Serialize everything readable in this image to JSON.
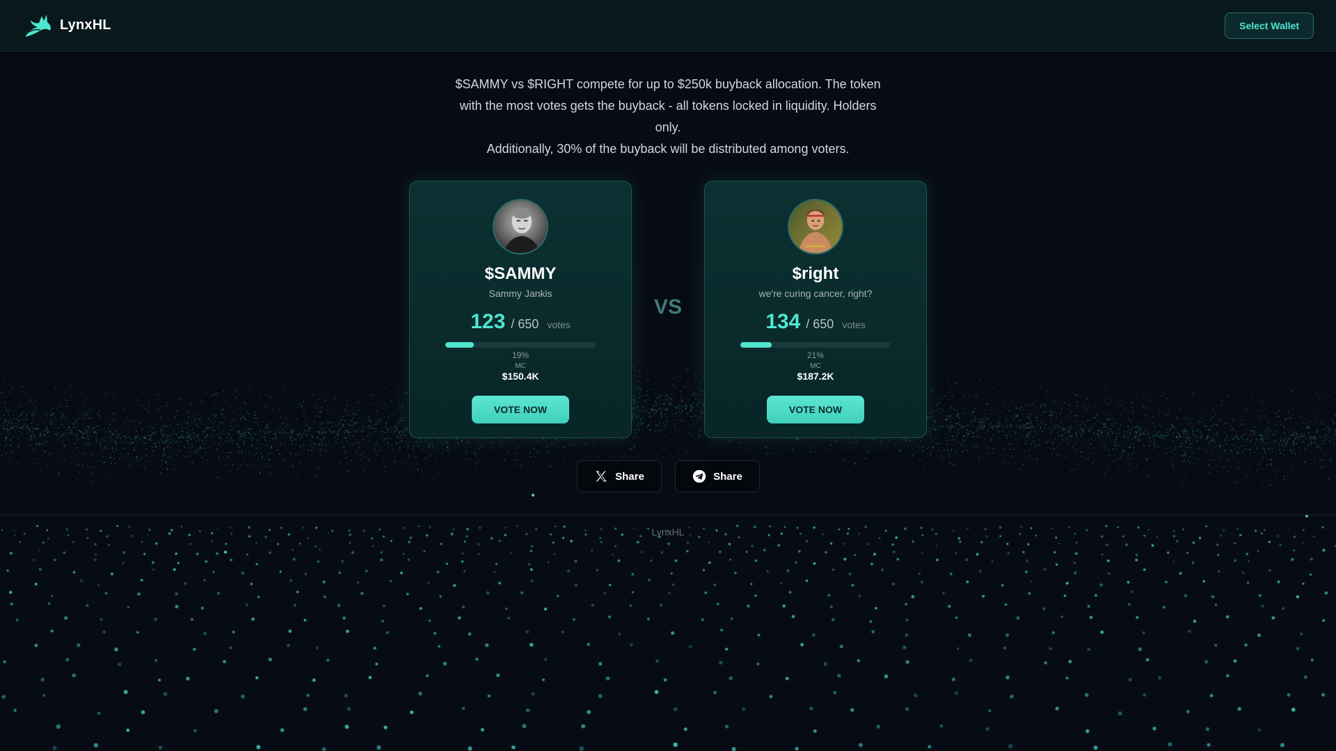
{
  "header": {
    "brand_name": "LynxHL",
    "wallet_button_label": "Select Wallet"
  },
  "intro": {
    "line1": "$SAMMY vs $RIGHT compete for up to $250k buyback allocation. The token with the most votes gets the buyback - all tokens locked in liquidity. Holders only.",
    "line2": "Additionally, 30% of the buyback will be distributed among voters."
  },
  "candidates": [
    {
      "ticker": "$SAMMY",
      "subtitle": "Sammy Jankis",
      "votes": "123",
      "votes_total": "/ 650",
      "votes_label": "votes",
      "progress": 0.19,
      "percent_label": "19%",
      "mc_label": "MC",
      "mc_value": "$150.4K",
      "vote_button_label": "VOTE NOW"
    },
    {
      "ticker": "$right",
      "subtitle": "we're curing cancer, right?",
      "votes": "134",
      "votes_total": "/ 650",
      "votes_label": "votes",
      "progress": 0.21,
      "percent_label": "21%",
      "mc_label": "MC",
      "mc_value": "$187.2K",
      "vote_button_label": "VOTE NOW"
    }
  ],
  "vs_label": "VS",
  "share": {
    "x_label": "Share",
    "telegram_label": "Share"
  },
  "footer": {
    "text": "LynxHL"
  },
  "colors": {
    "accent": "#4ee6cf",
    "background": "#070b14",
    "card": "#0c3132"
  },
  "icons": {
    "brand": "lynx-logo-icon",
    "x": "x-logo-icon",
    "telegram": "telegram-icon"
  }
}
